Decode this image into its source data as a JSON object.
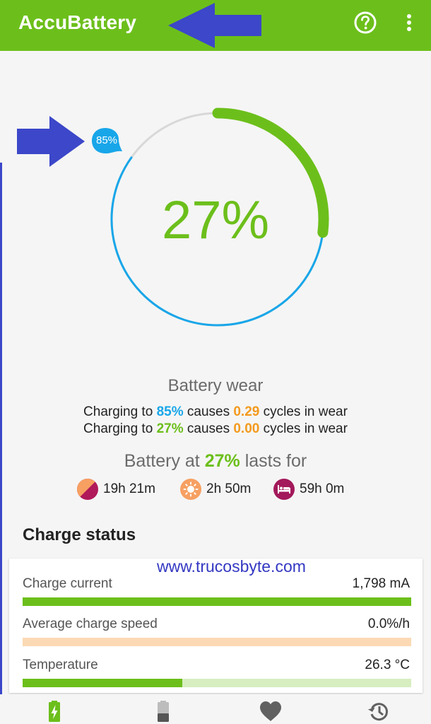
{
  "app": {
    "title": "AccuBattery",
    "accent": "#6cbf1b"
  },
  "appbar": {
    "help_icon": "help-circle-icon",
    "more_icon": "more-vert-icon"
  },
  "gauge": {
    "percent_label": "27%",
    "charge_level": 27,
    "target_label": "85%",
    "target_level": 85
  },
  "wear": {
    "title": "Battery wear",
    "line1": {
      "prefix": "Charging to ",
      "percent": "85%",
      "middle": " causes ",
      "cycles": "0.29",
      "suffix": " cycles in wear"
    },
    "line2": {
      "prefix": "Charging to ",
      "percent": "27%",
      "middle": " causes ",
      "cycles": "0.00",
      "suffix": " cycles in wear"
    }
  },
  "lasts": {
    "prefix": "Battery at ",
    "percent": "27%",
    "suffix": " lasts for",
    "items": [
      {
        "icon": "screen-on-off-icon",
        "value": "19h 21m"
      },
      {
        "icon": "screen-on-sun-icon",
        "value": "2h 50m"
      },
      {
        "icon": "sleep-bed-icon",
        "value": "59h 0m"
      }
    ]
  },
  "charge_status": {
    "title": "Charge status",
    "watermark": "www.trucosbyte.com",
    "rows": [
      {
        "label": "Charge current",
        "value": "1,798 mA",
        "fill": 1.0,
        "fill_color": "#6cbf1b",
        "track_color": "#6cbf1b"
      },
      {
        "label": "Average charge speed",
        "value": "0.0%/h",
        "fill": 0.0,
        "fill_color": "#fbd9b4",
        "track_color": "#fbd9b4"
      },
      {
        "label": "Temperature",
        "value": "26.3 °C",
        "fill": 0.41,
        "fill_color": "#6cbf1b",
        "track_color": "#d7eec0"
      }
    ]
  },
  "nav": {
    "items": [
      {
        "icon": "battery-charging-icon",
        "active": true
      },
      {
        "icon": "battery-icon",
        "active": false
      },
      {
        "icon": "heart-icon",
        "active": false
      },
      {
        "icon": "history-icon",
        "active": false
      }
    ]
  }
}
